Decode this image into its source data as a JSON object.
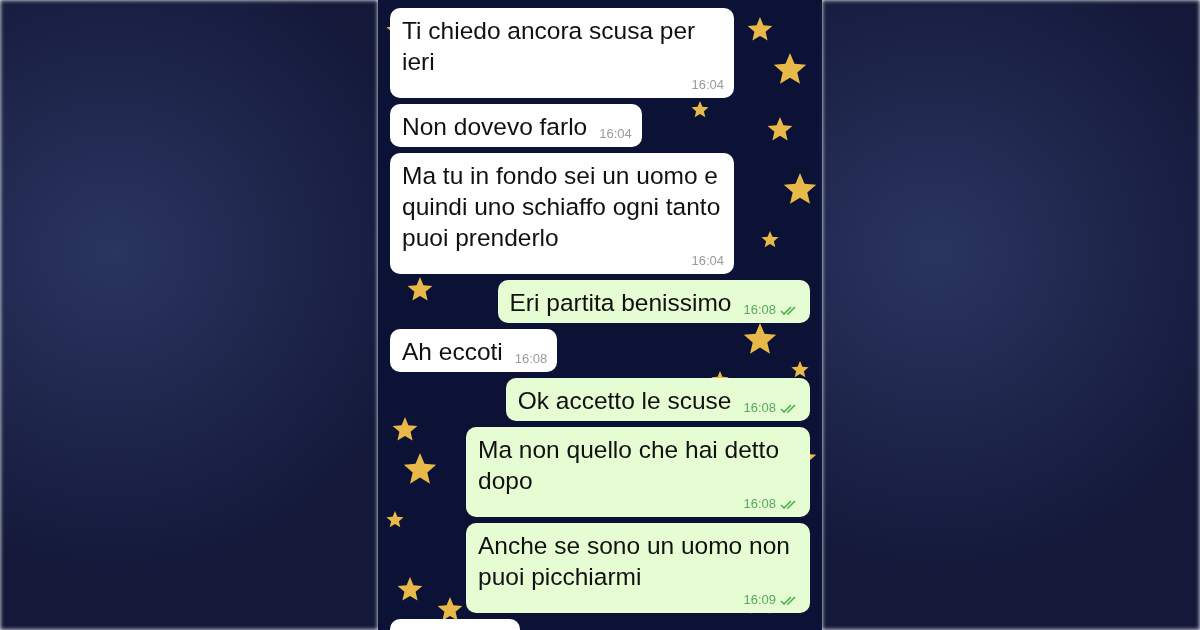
{
  "messages": [
    {
      "kind": "received",
      "text": "Ti chiedo ancora scusa per ieri",
      "time": "16:04"
    },
    {
      "kind": "received",
      "text": "Non dovevo farlo",
      "time": "16:04"
    },
    {
      "kind": "received",
      "text": "Ma tu in fondo sei un uomo e quindi uno schiaffo ogni tanto puoi prenderlo",
      "time": "16:04"
    },
    {
      "kind": "sent",
      "text": "Eri partita benissimo",
      "time": "16:08",
      "read": true
    },
    {
      "kind": "received",
      "text": "Ah eccoti",
      "time": "16:08"
    },
    {
      "kind": "sent",
      "text": "Ok accetto le scuse",
      "time": "16:08",
      "read": true
    },
    {
      "kind": "sent",
      "text": "Ma non quello che hai detto dopo",
      "time": "16:08",
      "read": true
    },
    {
      "kind": "sent",
      "text": "Anche se sono un uomo non puoi picchiarmi",
      "time": "16:09",
      "read": true
    }
  ]
}
